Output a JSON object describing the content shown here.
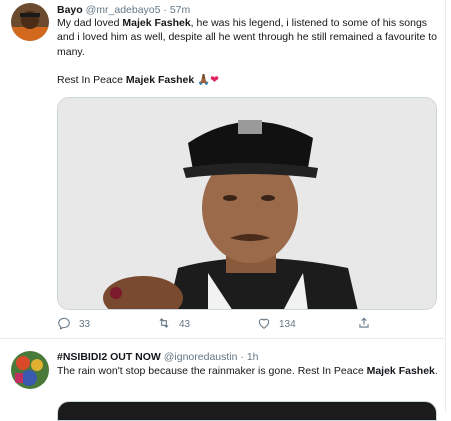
{
  "tweets": [
    {
      "name": "Bayo",
      "handle": "@mr_adebayo5",
      "sep": "·",
      "time": "57m",
      "text_a": "My dad loved ",
      "text_b": "Majek Fashek",
      "text_c": ", he was his legend, i listened to some of his songs and i loved him as well, despite all he went through he still remained a favourite to many.",
      "text_d": "Rest In Peace ",
      "text_e": "Majek Fashek",
      "emoji_pray": "🙏🏾",
      "emoji_heart": "❤",
      "replies": "33",
      "retweets": "43",
      "likes": "134"
    },
    {
      "name": "#NSIBIDI2 OUT NOW",
      "handle": "@ignoredaustin",
      "sep": "·",
      "time": "1h",
      "text_a": "The rain won't stop because the rainmaker is gone. Rest In Peace ",
      "text_b": "Majek Fashek",
      "text_c": "."
    }
  ],
  "icons": [
    "reply-icon",
    "retweet-icon",
    "like-icon",
    "share-icon"
  ],
  "colors": {
    "text": "#14171a",
    "secondary": "#657786",
    "border": "#e6ecf0",
    "heart": "#e0245e"
  }
}
